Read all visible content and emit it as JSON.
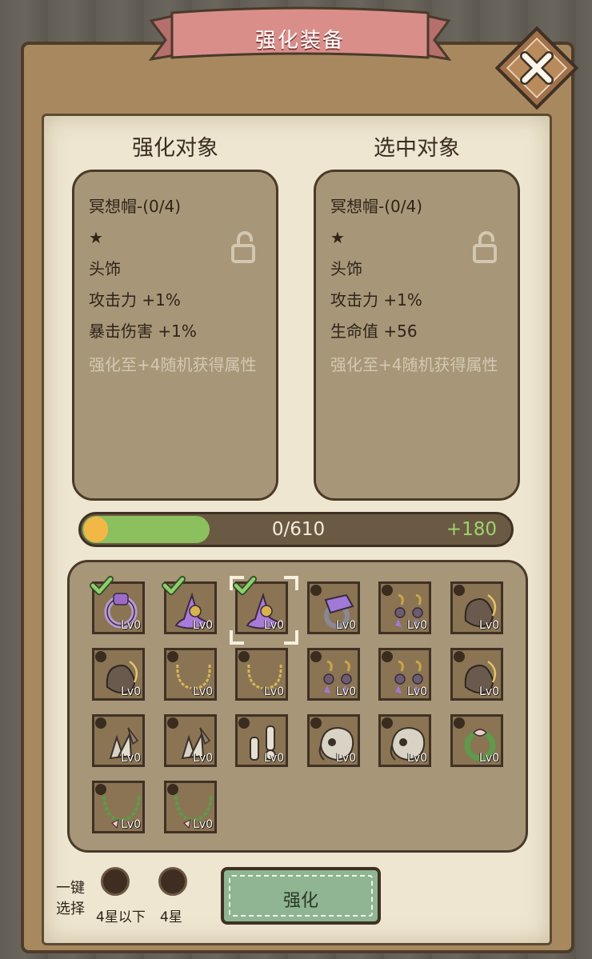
{
  "title": "强化装备",
  "left_panel": {
    "heading": "强化对象",
    "name": "冥想帽-(0/4)",
    "stars": "★",
    "slot_type": "头饰",
    "stats": [
      "攻击力 +1%",
      "暴击伤害 +1%"
    ],
    "hint": "强化至+4随机获得属性"
  },
  "right_panel": {
    "heading": "选中对象",
    "name": "冥想帽-(0/4)",
    "stars": "★",
    "slot_type": "头饰",
    "stats": [
      "攻击力 +1%",
      "生命值 +56"
    ],
    "hint": "强化至+4随机获得属性"
  },
  "progress": {
    "text": "0/610",
    "gain": "+180",
    "fill_fraction": 0.2951
  },
  "inventory": [
    {
      "icon": "ring-icon",
      "level": "Lv0",
      "checked": true
    },
    {
      "icon": "wizard-hat-icon",
      "level": "Lv0",
      "checked": true
    },
    {
      "icon": "wizard-hat-icon",
      "level": "Lv0",
      "checked": true,
      "selected": true
    },
    {
      "icon": "amethyst-ring-icon",
      "level": "Lv0"
    },
    {
      "icon": "earrings-icon",
      "level": "Lv0"
    },
    {
      "icon": "gauntlet-icon",
      "level": "Lv0"
    },
    {
      "icon": "gauntlet-icon",
      "level": "Lv0"
    },
    {
      "icon": "necklace-icon",
      "level": "Lv0"
    },
    {
      "icon": "necklace-icon",
      "level": "Lv0"
    },
    {
      "icon": "earrings-icon",
      "level": "Lv0"
    },
    {
      "icon": "earrings-icon",
      "level": "Lv0"
    },
    {
      "icon": "gauntlet-icon",
      "level": "Lv0"
    },
    {
      "icon": "claw-glove-icon",
      "level": "Lv0"
    },
    {
      "icon": "claw-glove-icon",
      "level": "Lv0"
    },
    {
      "icon": "bone-icon",
      "level": "Lv0"
    },
    {
      "icon": "skull-helm-icon",
      "level": "Lv0"
    },
    {
      "icon": "skull-helm-icon",
      "level": "Lv0"
    },
    {
      "icon": "vine-bracelet-icon",
      "level": "Lv0"
    },
    {
      "icon": "vine-necklace-icon",
      "level": "Lv0"
    },
    {
      "icon": "vine-necklace-icon",
      "level": "Lv0"
    }
  ],
  "bottom": {
    "one_key": "一键",
    "select": "选择",
    "option1": "4星以下",
    "option2": "4星",
    "enhance_button": "强化"
  },
  "colors": {
    "paper": "#eee6d1",
    "card": "#a89679",
    "progress_green": "#8cbf5e",
    "gain_text": "#9ed36d",
    "button_green": "#8fb592",
    "ribbon": "#d98e8a"
  }
}
